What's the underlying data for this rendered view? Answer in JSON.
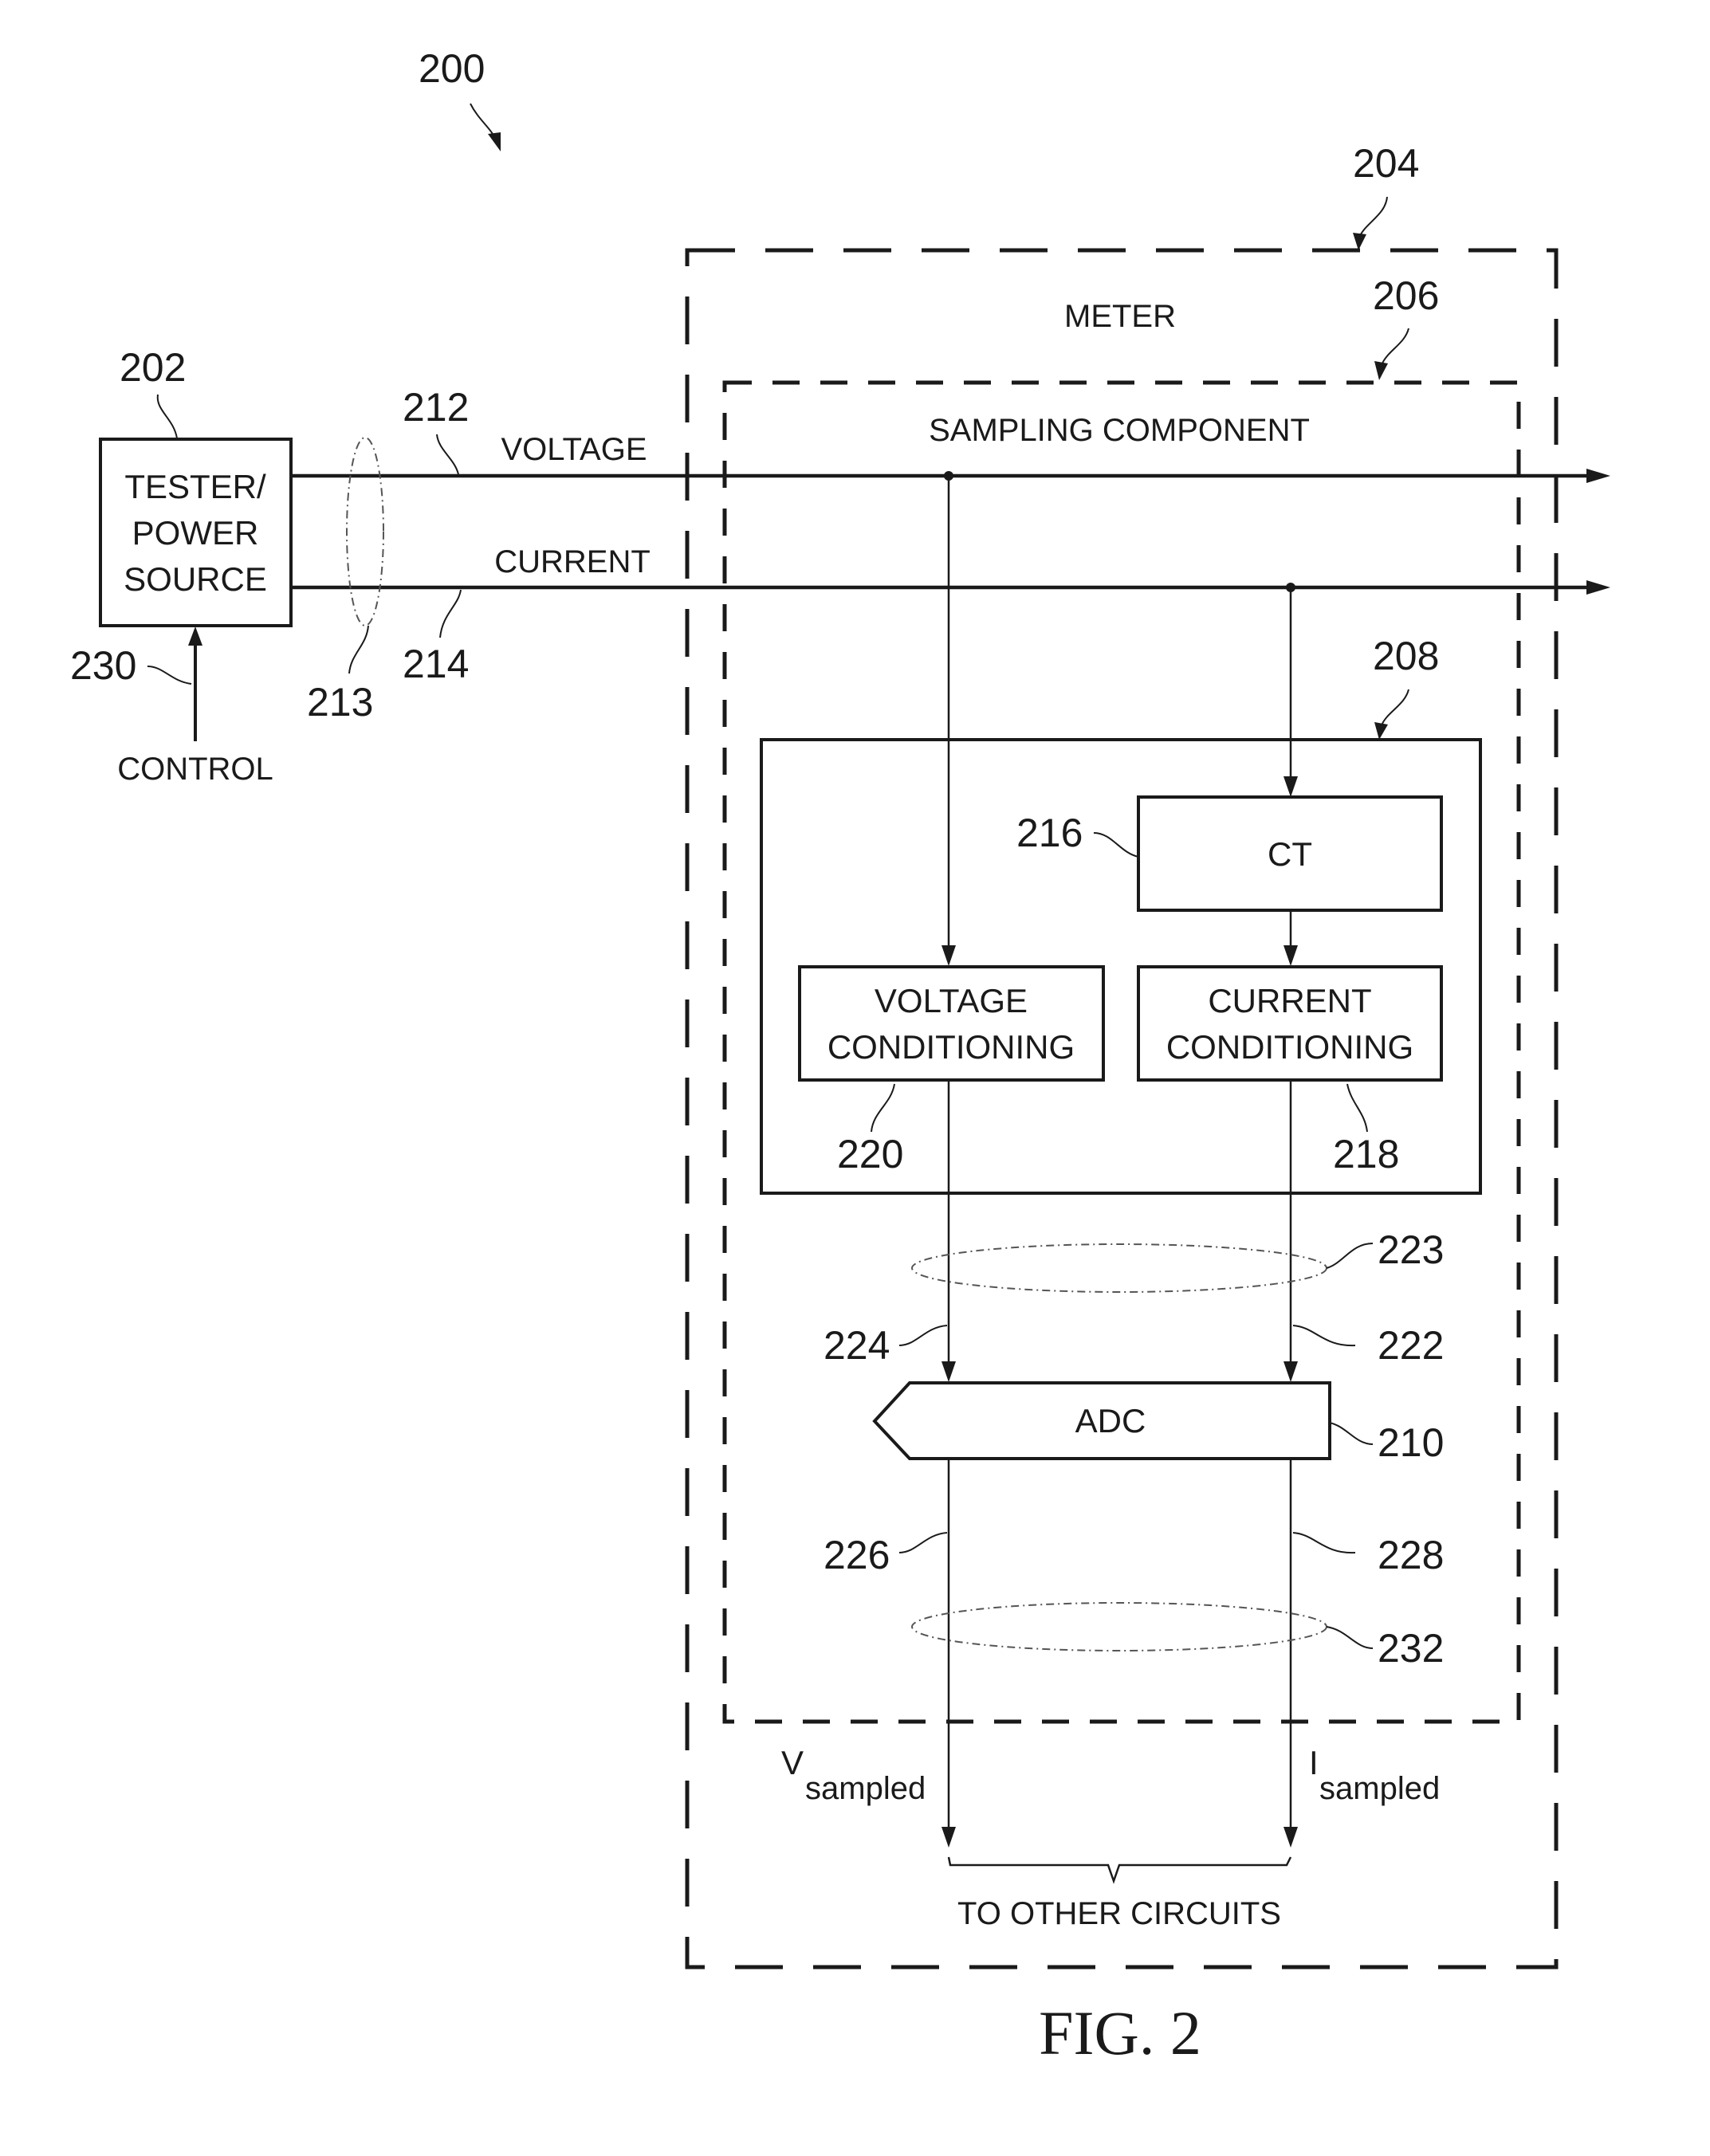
{
  "figure": {
    "caption": "FIG. 2",
    "ref_system": "200"
  },
  "tester": {
    "ref": "202",
    "lines": [
      "TESTER/",
      "POWER",
      "SOURCE"
    ],
    "control_label": "CONTROL",
    "control_ref": "230"
  },
  "signals": {
    "voltage_label": "VOLTAGE",
    "voltage_ref": "212",
    "current_label": "CURRENT",
    "current_ref": "214",
    "bundle_ref": "213"
  },
  "meter": {
    "ref": "204",
    "label": "METER"
  },
  "sampling": {
    "ref": "206",
    "label": "SAMPLING COMPONENT"
  },
  "conditioning_block": {
    "ref": "208"
  },
  "ct": {
    "ref": "216",
    "label": "CT"
  },
  "voltage_conditioning": {
    "ref": "220",
    "lines": [
      "VOLTAGE",
      "CONDITIONING"
    ]
  },
  "current_conditioning": {
    "ref": "218",
    "lines": [
      "CURRENT",
      "CONDITIONING"
    ]
  },
  "adc": {
    "ref": "210",
    "label": "ADC",
    "input_bundle_ref": "223",
    "voltage_input_ref": "224",
    "current_input_ref": "222",
    "voltage_output_ref": "226",
    "current_output_ref": "228",
    "output_bundle_ref": "232"
  },
  "outputs": {
    "v_main": "V",
    "v_sub": "sampled",
    "i_main": "I",
    "i_sub": "sampled",
    "destination": "TO OTHER CIRCUITS"
  }
}
